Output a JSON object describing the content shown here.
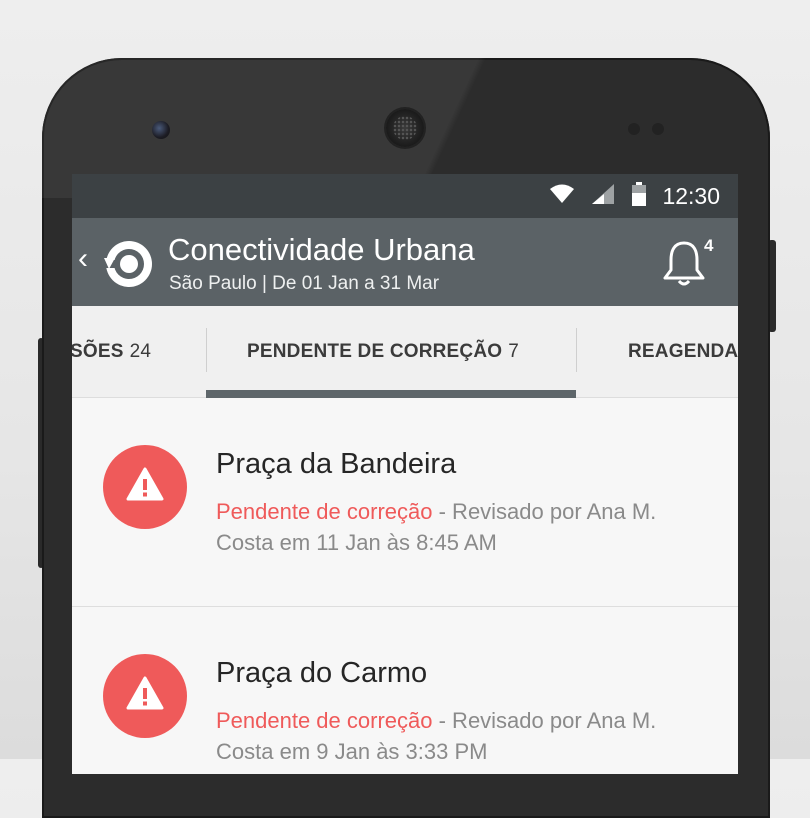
{
  "status_bar": {
    "time": "12:30"
  },
  "app_bar": {
    "back_glyph": "‹",
    "title": "Conectividade Urbana",
    "subtitle": "São Paulo | De 01 Jan a 31 Mar",
    "notification_count": "4"
  },
  "tabs": [
    {
      "label": "SÕES",
      "count": "24"
    },
    {
      "label": "PENDENTE DE CORREÇÃO",
      "count": "7"
    },
    {
      "label": "REAGENDA",
      "count": ""
    }
  ],
  "items": [
    {
      "title": "Praça da Bandeira",
      "status": "Pendente de correção",
      "detail": " - Revisado por Ana M. Costa em 11 Jan às 8:45 AM"
    },
    {
      "title": "Praça do Carmo",
      "status": "Pendente de correção",
      "detail": " - Revisado por Ana M. Costa em 9 Jan às 3:33 PM"
    }
  ],
  "colors": {
    "accent_red": "#ef5a5a",
    "app_bar": "#5b6266",
    "status_bar": "#3c4144"
  },
  "icons": [
    "wifi-icon",
    "signal-icon",
    "battery-icon",
    "back-arrow-icon",
    "app-logo-icon",
    "bell-icon",
    "warning-icon"
  ]
}
